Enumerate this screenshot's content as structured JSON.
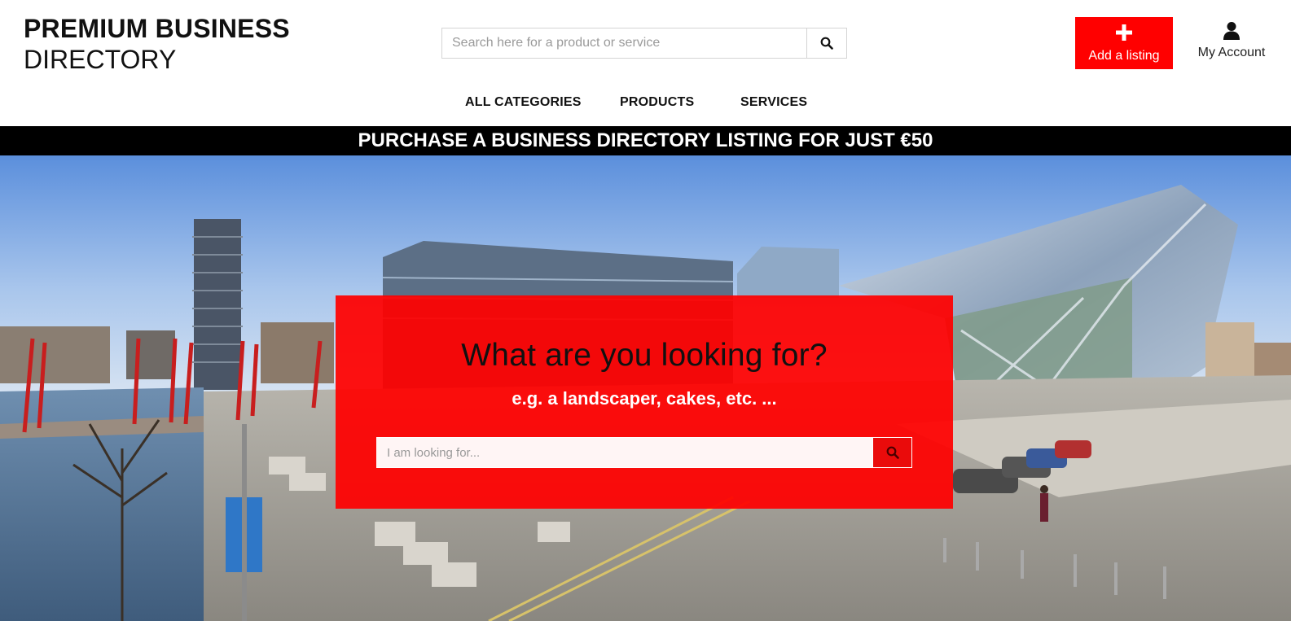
{
  "logo": {
    "line1": "PREMIUM BUSINESS",
    "line2": "DIRECTORY"
  },
  "header_search": {
    "placeholder": "Search here for a product or service",
    "icon": "search-icon"
  },
  "add_listing": {
    "label": "Add a listing",
    "icon": "plus-icon",
    "color": "#ff0000"
  },
  "account": {
    "label": "My Account",
    "icon": "user-icon"
  },
  "nav": {
    "all_categories": "ALL CATEGORIES",
    "products": "PRODUCTS",
    "services": "SERVICES"
  },
  "promo_banner": {
    "text": "PURCHASE A BUSINESS DIRECTORY LISTING FOR JUST €50",
    "background": "#000000"
  },
  "hero": {
    "title": "What are you looking for?",
    "subtitle": "e.g. a landscaper, cakes, etc. ...",
    "search_placeholder": "I am looking for...",
    "panel_color": "#ff0000",
    "image": "city waterfront with glass theatre building"
  }
}
